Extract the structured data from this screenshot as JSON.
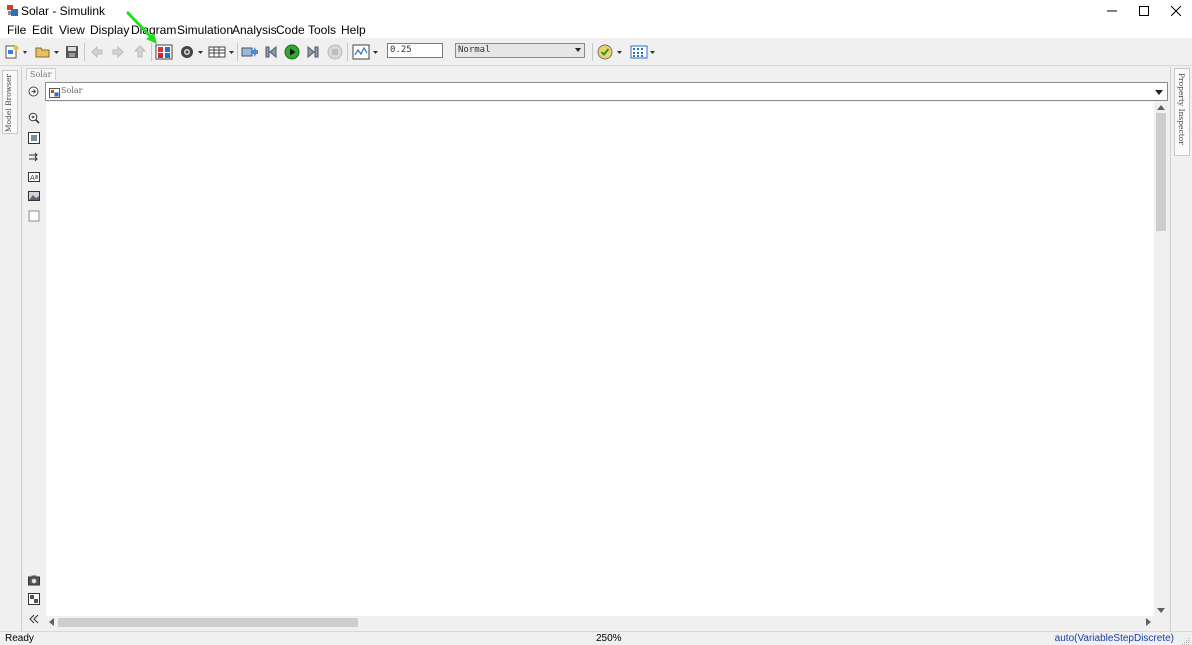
{
  "window": {
    "title": "Solar - Simulink",
    "controls": [
      "minimize",
      "maximize",
      "close"
    ]
  },
  "menu": {
    "items": [
      "File",
      "Edit",
      "View",
      "Display",
      "Diagram",
      "Simulation",
      "Analysis",
      "Code",
      "Tools",
      "Help"
    ]
  },
  "toolbar": {
    "stop_time": "0.25",
    "sim_mode": "Normal",
    "icons": [
      "new-model-icon",
      "open-icon",
      "save-icon",
      "back-icon",
      "forward-icon",
      "up-icon",
      "library-browser-icon",
      "model-config-icon",
      "model-explorer-icon",
      "build-icon",
      "step-back-icon",
      "run-icon",
      "step-forward-icon",
      "stop-icon",
      "scope-icon",
      "model-advisor-icon",
      "grid-icon"
    ]
  },
  "left_panel": {
    "model_browser_label": "Model Browser"
  },
  "editor": {
    "tab_label": "Solar",
    "breadcrumb": "Solar"
  },
  "right_panel": {
    "property_inspector_label": "Property Inspector"
  },
  "status": {
    "state": "Ready",
    "zoom": "250%",
    "solver": "auto(VariableStepDiscrete)"
  },
  "colors": {
    "pointer": "#22dd22",
    "run_green": "#2fa82f",
    "solver_text": "#1a3fa8"
  }
}
